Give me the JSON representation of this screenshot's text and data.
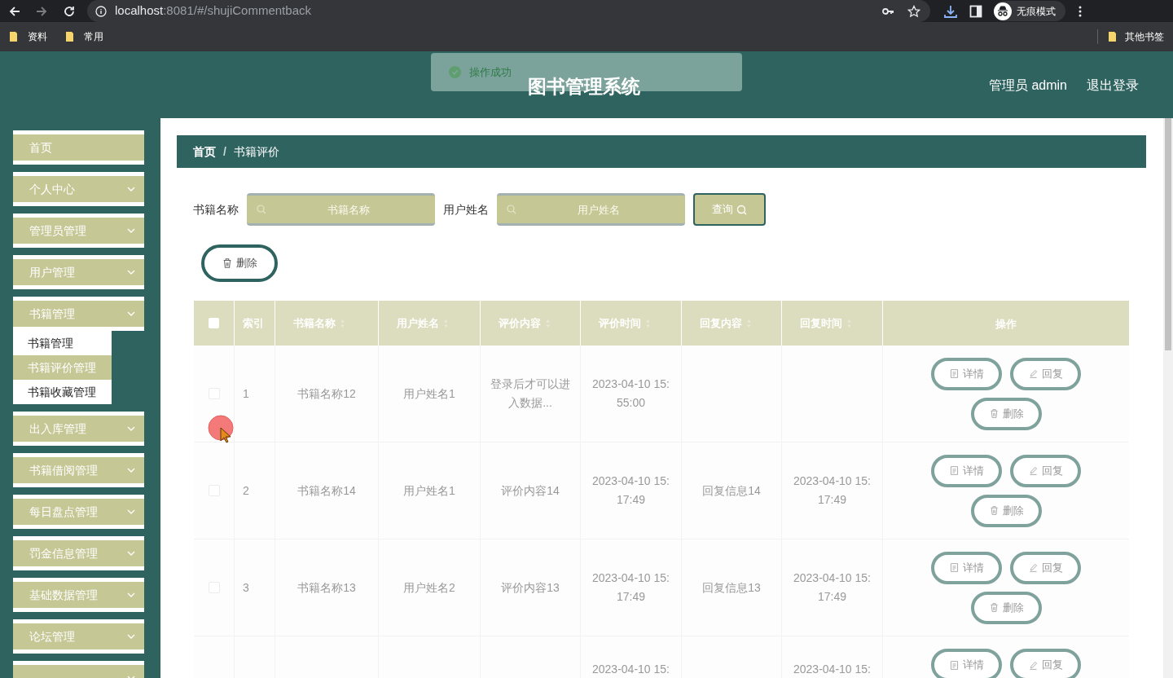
{
  "browser": {
    "url_host": "localhost",
    "url_path": ":8081/#/shujiCommentback",
    "profile": "无痕模式",
    "bookmarks": [
      "资料",
      "常用"
    ],
    "other_bookmarks": "其他书签"
  },
  "toast": {
    "message": "操作成功"
  },
  "header": {
    "title": "图书管理系统",
    "user": "管理员 admin",
    "logout": "退出登录"
  },
  "sidebar": {
    "items": [
      {
        "label": "首页",
        "expandable": false
      },
      {
        "label": "个人中心",
        "expandable": true
      },
      {
        "label": "管理员管理",
        "expandable": true
      },
      {
        "label": "用户管理",
        "expandable": true
      },
      {
        "label": "书籍管理",
        "expandable": true,
        "children": [
          {
            "label": "书籍管理",
            "selected": false
          },
          {
            "label": "书籍评价管理",
            "selected": true
          },
          {
            "label": "书籍收藏管理",
            "selected": false
          }
        ]
      },
      {
        "label": "出入库管理",
        "expandable": true
      },
      {
        "label": "书籍借阅管理",
        "expandable": true
      },
      {
        "label": "每日盘点管理",
        "expandable": true
      },
      {
        "label": "罚金信息管理",
        "expandable": true
      },
      {
        "label": "基础数据管理",
        "expandable": true
      },
      {
        "label": "论坛管理",
        "expandable": true
      },
      {
        "expandable": true
      }
    ]
  },
  "breadcrumb": {
    "items": [
      "首页",
      "书籍评价"
    ],
    "separator": "/"
  },
  "search": {
    "fields": [
      {
        "label": "书籍名称",
        "placeholder": "书籍名称"
      },
      {
        "label": "用户姓名",
        "placeholder": "用户姓名"
      }
    ],
    "button": "查询"
  },
  "toolbar": {
    "delete": "删除"
  },
  "table": {
    "select_all_checked": false,
    "columns": [
      {
        "label": "索引",
        "sortable": false
      },
      {
        "label": "书籍名称",
        "sortable": true
      },
      {
        "label": "用户姓名",
        "sortable": true
      },
      {
        "label": "评价内容",
        "sortable": true
      },
      {
        "label": "评价时间",
        "sortable": true
      },
      {
        "label": "回复内容",
        "sortable": true
      },
      {
        "label": "回复时间",
        "sortable": true
      }
    ],
    "actions_label": "操作",
    "rows": [
      {
        "checked": false,
        "cells": [
          "1",
          "书籍名称12",
          "用户姓名1",
          "登录后才可以进入数据...",
          "2023-04-10 15:55:00",
          null,
          null
        ],
        "actions": [
          {
            "kind": "detail",
            "label": "详情"
          },
          {
            "kind": "reply",
            "label": "回复"
          },
          {
            "kind": "delete",
            "label": "删除"
          }
        ]
      },
      {
        "checked": false,
        "cells": [
          "2",
          "书籍名称14",
          "用户姓名1",
          "评价内容14",
          "2023-04-10 15:17:49",
          "回复信息14",
          "2023-04-10 15:17:49"
        ],
        "actions": [
          {
            "kind": "detail",
            "label": "详情"
          },
          {
            "kind": "reply",
            "label": "回复"
          },
          {
            "kind": "delete",
            "label": "删除"
          }
        ]
      },
      {
        "checked": false,
        "cells": [
          "3",
          "书籍名称13",
          "用户姓名2",
          "评价内容13",
          "2023-04-10 15:17:49",
          "回复信息13",
          "2023-04-10 15:17:49"
        ],
        "actions": [
          {
            "kind": "detail",
            "label": "详情"
          },
          {
            "kind": "reply",
            "label": "回复"
          },
          {
            "kind": "delete",
            "label": "删除"
          }
        ]
      },
      {
        "cells": [
          null,
          null,
          null,
          null,
          "2023-04-10 15:",
          null,
          "2023-04-10 15:"
        ],
        "actions": [
          {
            "kind": "detail",
            "label": "详情"
          },
          {
            "kind": "reply",
            "label": "回复"
          }
        ]
      }
    ]
  }
}
